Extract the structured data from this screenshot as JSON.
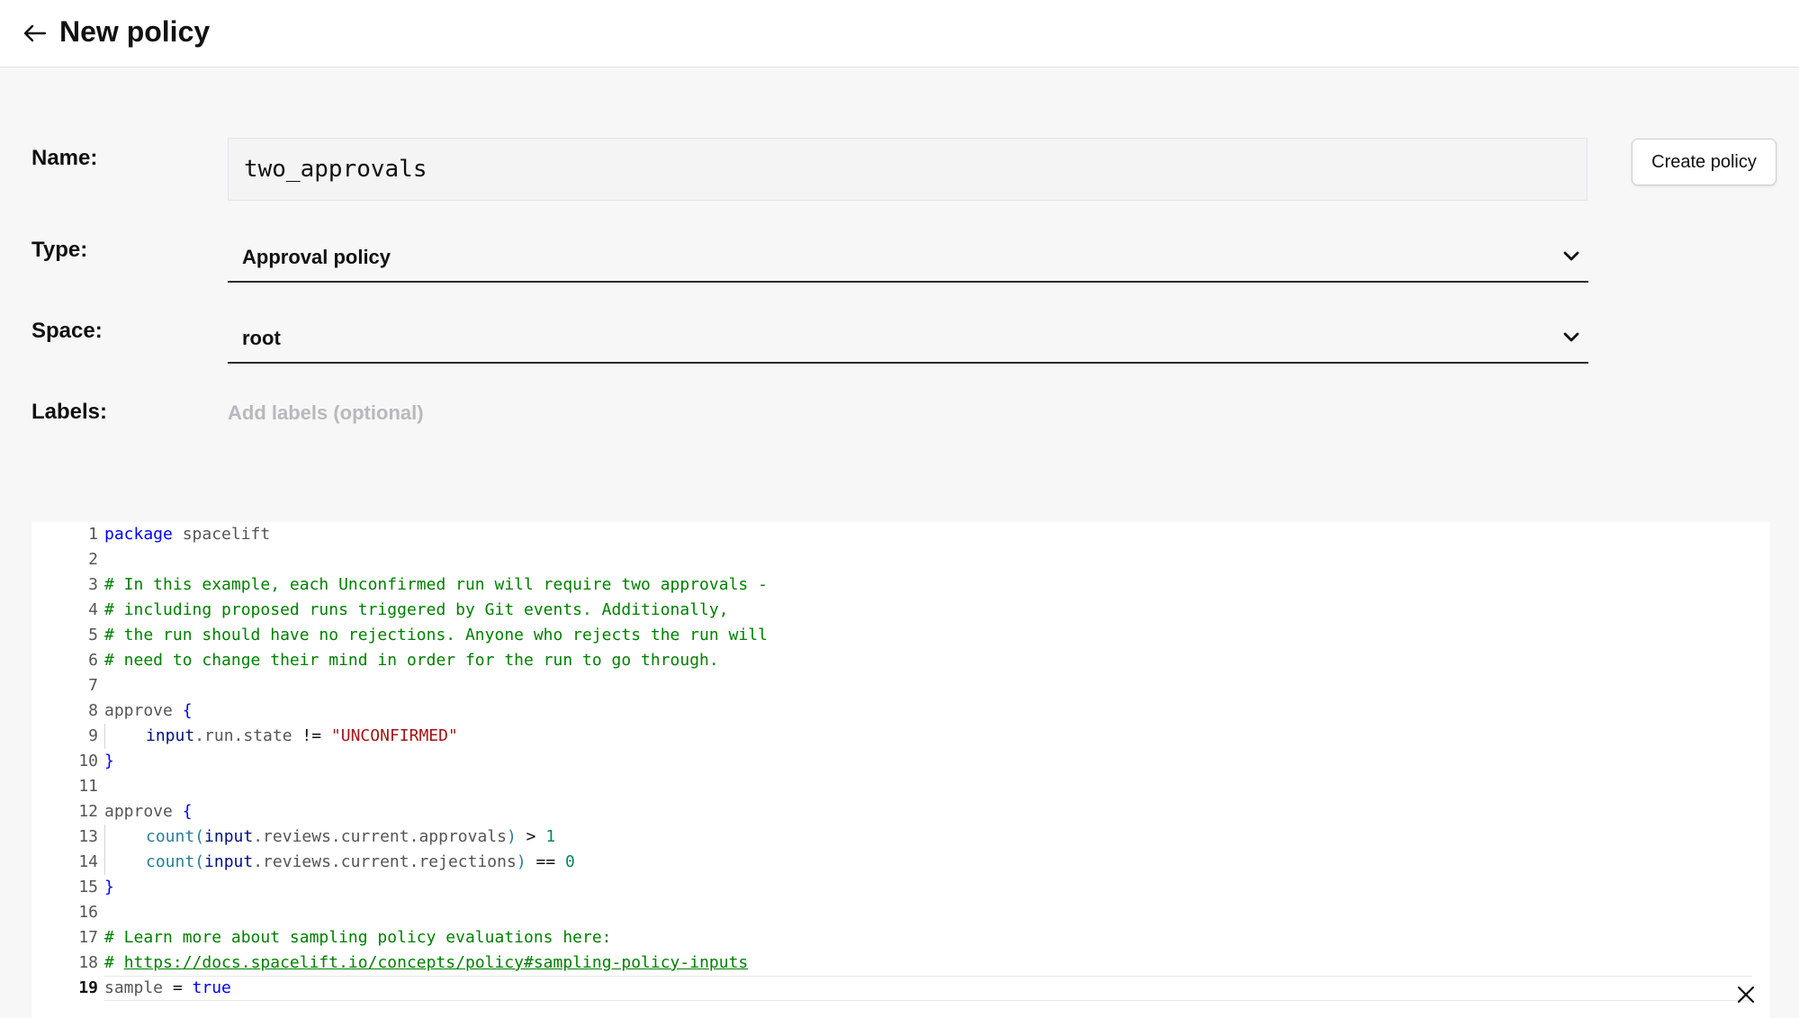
{
  "header": {
    "title": "New policy"
  },
  "form": {
    "name_label": "Name:",
    "name_value": "two_approvals",
    "type_label": "Type:",
    "type_value": "Approval policy",
    "space_label": "Space:",
    "space_value": "root",
    "labels_label": "Labels:",
    "labels_placeholder": "Add labels (optional)",
    "create_button": "Create policy"
  },
  "editor": {
    "line_numbers": [
      "1",
      "2",
      "3",
      "4",
      "5",
      "6",
      "7",
      "8",
      "9",
      "10",
      "11",
      "12",
      "13",
      "14",
      "15",
      "16",
      "17",
      "18",
      "19"
    ],
    "active_line": 19,
    "tokens": {
      "l1_kw": "package",
      "l1_rest": " spacelift",
      "l3": "# In this example, each Unconfirmed run will require two approvals -",
      "l4": "# including proposed runs triggered by Git events. Additionally,",
      "l5": "# the run should have no rejections. Anyone who rejects the run will",
      "l6": "# need to change their mind in order for the run to go through.",
      "approve": "approve",
      "open_brace": " {",
      "close_brace": "}",
      "input": "input",
      "l9_path": ".run.state",
      "l9_op": " != ",
      "l9_str": "\"UNCONFIRMED\"",
      "count": "count",
      "paren_open": "(",
      "l13_path": ".reviews.current.approvals",
      "paren_close": ")",
      "l13_op": " > ",
      "l13_num": "1",
      "l14_path": ".reviews.current.rejections",
      "l14_op": " == ",
      "l14_num": "0",
      "l17": "# Learn more about sampling policy evaluations here:",
      "l18_hash": "# ",
      "l18_url": "https://docs.spacelift.io/concepts/policy#sampling-policy-inputs",
      "l19_var": "sample",
      "l19_op": " = ",
      "l19_val": "true"
    }
  },
  "icons": {
    "back": "arrow-left-icon",
    "dropdown": "chevron-down-icon",
    "close": "close-icon"
  }
}
